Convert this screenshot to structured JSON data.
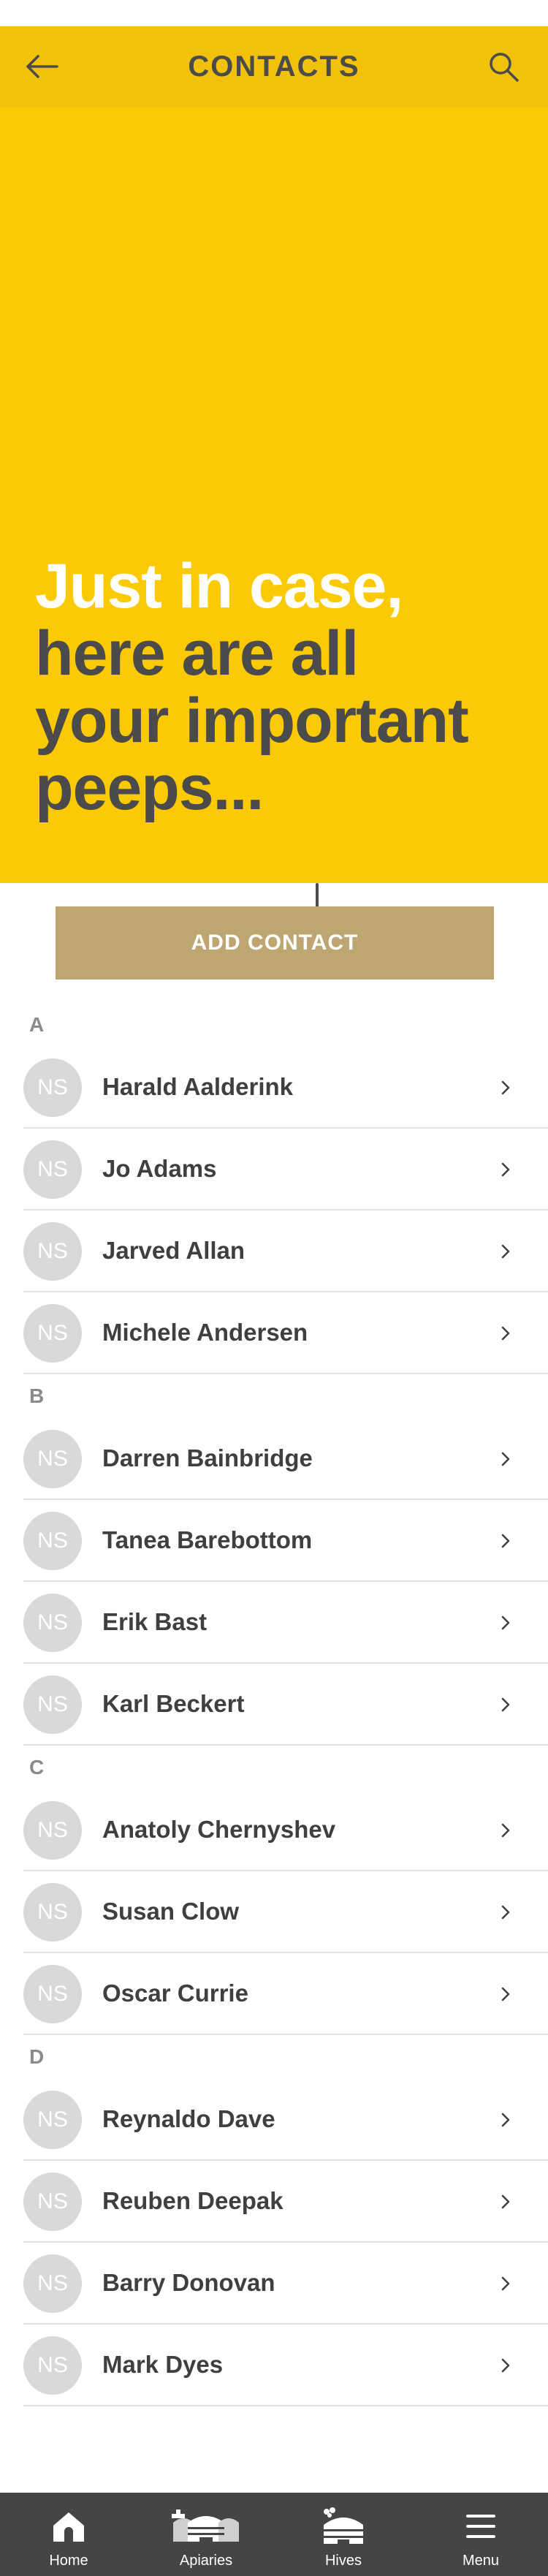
{
  "header": {
    "title": "CONTACTS",
    "back_icon": "arrow-left-icon",
    "search_icon": "search-icon"
  },
  "hero": {
    "lines": [
      "Just in case,",
      "here are all",
      "your important",
      "peeps..."
    ],
    "arrow_icon": "arrow-down-icon"
  },
  "add_contact": {
    "label": "ADD CONTACT"
  },
  "sections": [
    {
      "letter": "A",
      "contacts": [
        {
          "initials": "NS",
          "name": "Harald Aalderink"
        },
        {
          "initials": "NS",
          "name": "Jo Adams"
        },
        {
          "initials": "NS",
          "name": "Jarved Allan"
        },
        {
          "initials": "NS",
          "name": "Michele Andersen"
        }
      ]
    },
    {
      "letter": "B",
      "contacts": [
        {
          "initials": "NS",
          "name": "Darren Bainbridge"
        },
        {
          "initials": "NS",
          "name": "Tanea Barebottom"
        },
        {
          "initials": "NS",
          "name": "Erik Bast"
        },
        {
          "initials": "NS",
          "name": "Karl Beckert"
        }
      ]
    },
    {
      "letter": "C",
      "contacts": [
        {
          "initials": "NS",
          "name": "Anatoly Chernyshev"
        },
        {
          "initials": "NS",
          "name": "Susan Clow"
        },
        {
          "initials": "NS",
          "name": "Oscar Currie"
        }
      ]
    },
    {
      "letter": "D",
      "contacts": [
        {
          "initials": "NS",
          "name": "Reynaldo Dave"
        },
        {
          "initials": "NS",
          "name": "Reuben Deepak"
        },
        {
          "initials": "NS",
          "name": "Barry Donovan"
        },
        {
          "initials": "NS",
          "name": "Mark Dyes"
        }
      ]
    }
  ],
  "bottom_nav": [
    {
      "label": "Home",
      "icon": "home-icon"
    },
    {
      "label": "Apiaries",
      "icon": "apiaries-icon"
    },
    {
      "label": "Hives",
      "icon": "hive-icon"
    },
    {
      "label": "Menu",
      "icon": "hamburger-menu-icon"
    }
  ],
  "colors": {
    "header_bg": "#f2c10b",
    "hero_bg": "#fbca04",
    "button_bg": "#bea672",
    "text_dark": "#4b4b4b",
    "nav_bg": "#454545"
  }
}
